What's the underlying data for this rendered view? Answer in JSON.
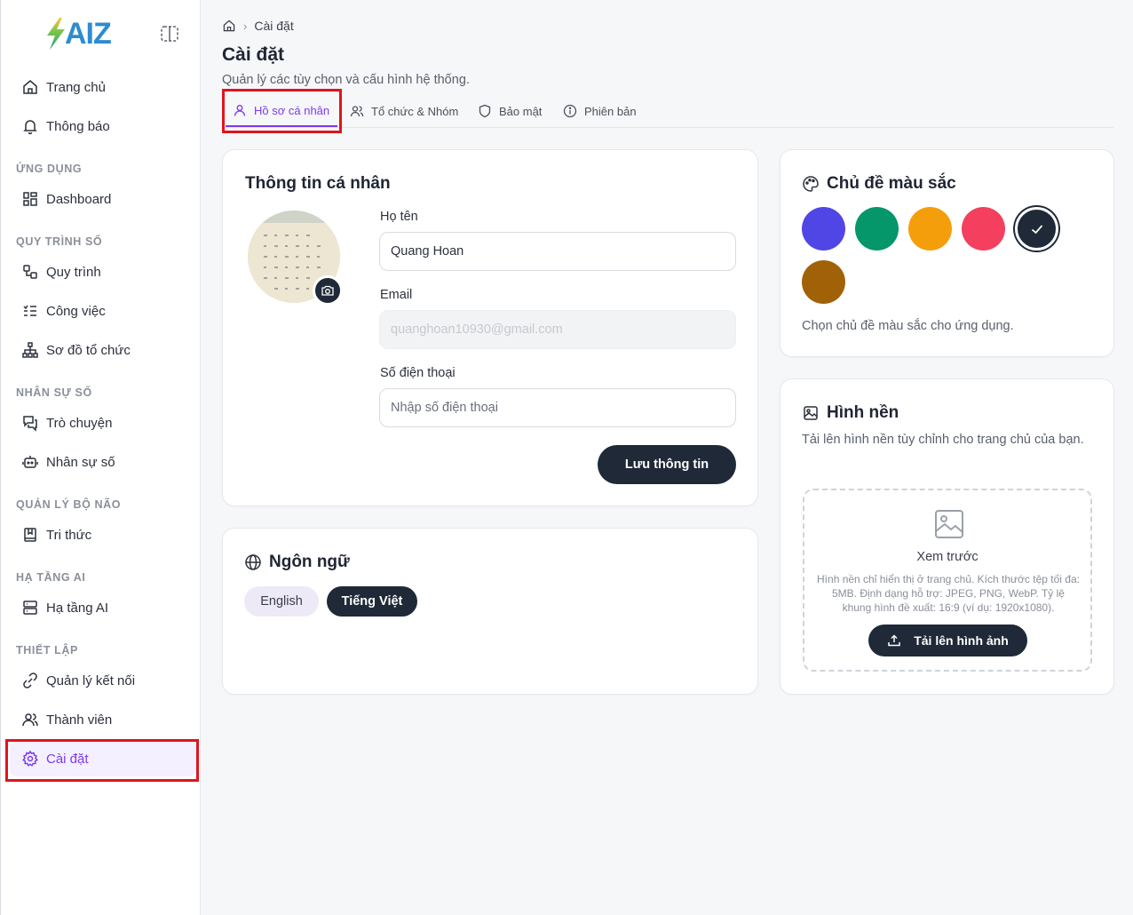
{
  "brand": {
    "logo_text": "AIZ"
  },
  "sidebar": {
    "items": [
      {
        "label": "Trang chủ",
        "icon": "home-icon"
      },
      {
        "label": "Thông báo",
        "icon": "bell-icon"
      },
      {
        "label": "Dashboard",
        "icon": "dashboard-icon"
      },
      {
        "label": "Quy trình",
        "icon": "workflow-icon"
      },
      {
        "label": "Công việc",
        "icon": "task-list-icon"
      },
      {
        "label": "Sơ đồ tổ chức",
        "icon": "org-chart-icon"
      },
      {
        "label": "Trò chuyện",
        "icon": "chat-icon"
      },
      {
        "label": "Nhân sự số",
        "icon": "bot-icon"
      },
      {
        "label": "Tri thức",
        "icon": "book-icon"
      },
      {
        "label": "Hạ tầng AI",
        "icon": "server-icon"
      },
      {
        "label": "Quản lý kết nối",
        "icon": "link-icon"
      },
      {
        "label": "Thành viên",
        "icon": "users-icon"
      },
      {
        "label": "Cài đặt",
        "icon": "gear-icon"
      }
    ],
    "sections": [
      "ỨNG DỤNG",
      "QUY TRÌNH SỐ",
      "NHÂN SỰ SỐ",
      "QUẢN LÝ BỘ NÃO",
      "HẠ TẦNG AI",
      "THIẾT LẬP"
    ],
    "active": "Cài đặt"
  },
  "breadcrumb": {
    "current": "Cài đặt"
  },
  "page": {
    "title": "Cài đặt",
    "subtitle": "Quản lý các tùy chọn và cấu hình hệ thống."
  },
  "tabs": [
    {
      "label": "Hồ sơ cá nhân",
      "active": true
    },
    {
      "label": "Tổ chức & Nhóm",
      "active": false
    },
    {
      "label": "Bảo mật",
      "active": false
    },
    {
      "label": "Phiên bản",
      "active": false
    }
  ],
  "profile": {
    "title": "Thông tin cá nhân",
    "name_label": "Họ tên",
    "name_value": "Quang Hoan",
    "email_label": "Email",
    "email_value": "quanghoan10930@gmail.com",
    "phone_label": "Số điện thoại",
    "phone_placeholder": "Nhập số điện thoại",
    "save_label": "Lưu thông tin"
  },
  "language": {
    "title": "Ngôn ngữ",
    "options": [
      "English",
      "Tiếng Việt"
    ],
    "selected": "Tiếng Việt"
  },
  "theme": {
    "title": "Chủ đề màu sắc",
    "colors": [
      "#4f46e5",
      "#059669",
      "#f59e0b",
      "#f43f5e",
      "#1f2937",
      "#a16207"
    ],
    "selected": "#1f2937",
    "hint": "Chọn chủ đề màu sắc cho ứng dụng."
  },
  "wallpaper": {
    "title": "Hình nền",
    "description": "Tải lên hình nền tùy chỉnh cho trang chủ của bạn.",
    "preview_label": "Xem trước",
    "preview_note": "Hình nền chỉ hiển thị ở trang chủ. Kích thước tệp tối đa: 5MB. Định dạng hỗ trợ: JPEG, PNG, WebP. Tỷ lệ khung hình đề xuất: 16:9 (ví dụ: 1920x1080).",
    "upload_label": "Tải lên hình ảnh"
  }
}
